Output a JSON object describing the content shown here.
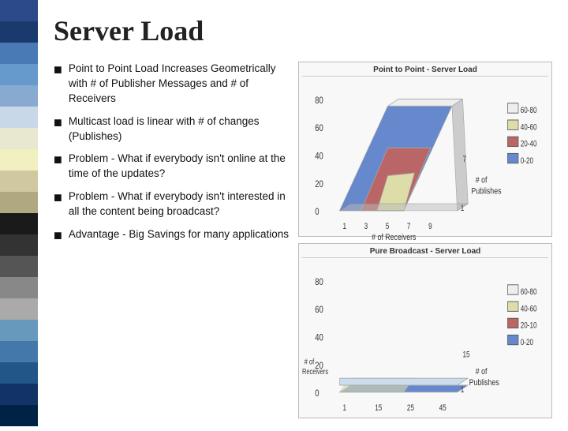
{
  "sidebar": {
    "colors": [
      "#2c4a8a",
      "#1a3a6e",
      "#4a7ab5",
      "#6699cc",
      "#88aad0",
      "#c8d8e8",
      "#e8e8d0",
      "#f0f0c0",
      "#d0c8a0",
      "#b0a880",
      "#1a1a1a",
      "#333333",
      "#555555",
      "#888888",
      "#aaaaaa",
      "#6699bb",
      "#4477aa",
      "#225588",
      "#113366",
      "#002244"
    ]
  },
  "title": "Server Load",
  "bullets": [
    {
      "text": "Point to Point Load Increases Geometrically with # of Publisher Messages and # of Receivers"
    },
    {
      "text": "Multicast load is linear with # of changes (Publishes)"
    },
    {
      "text": "Problem - What if everybody isn't online at the time of the updates?"
    },
    {
      "text": "Problem - What if everybody isn't interested in all the content being broadcast?"
    },
    {
      "text": "Advantage - Big Savings for many applications"
    }
  ],
  "chart1": {
    "title": "Point to Point - Server Load",
    "yAxis": "80, 60, 40, 20, 0",
    "xAxisLabel": "# of Receivers",
    "yAxisLabel": "# of Publishes",
    "legend": [
      {
        "label": "60-80",
        "color": "#ffffff"
      },
      {
        "label": "40-60",
        "color": "#ddddaa"
      },
      {
        "label": "20-40",
        "color": "#bb6666"
      },
      {
        "label": "0-20",
        "color": "#6688cc"
      }
    ]
  },
  "chart2": {
    "title": "Pure Broadcast - Server Load",
    "yAxis": "80, 60, 40, 20, 0",
    "xAxisLabel": "# of Publishes",
    "yAxisLabel2": "# of Receivers",
    "legend": [
      {
        "label": "60-80",
        "color": "#ffffff"
      },
      {
        "label": "40-60",
        "color": "#ddddaa"
      },
      {
        "label": "20-10",
        "color": "#bb6666"
      },
      {
        "label": "0-20",
        "color": "#6688cc"
      }
    ]
  }
}
